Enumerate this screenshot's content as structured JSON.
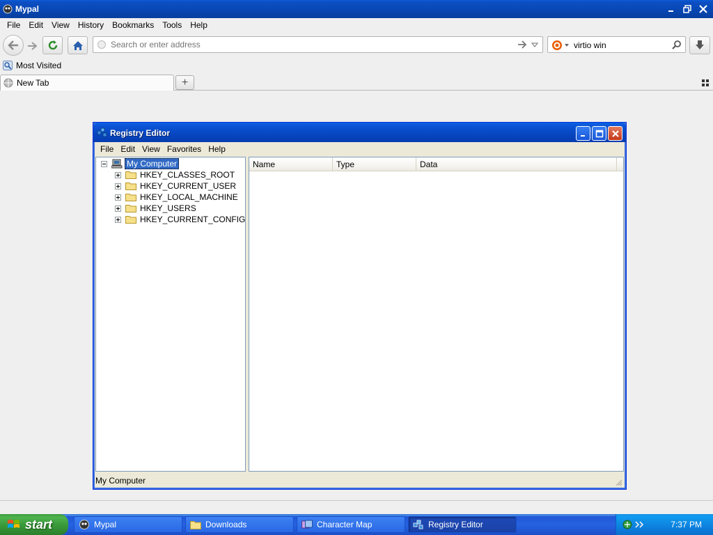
{
  "browser": {
    "title": "Mypal",
    "menu": [
      "File",
      "Edit",
      "View",
      "History",
      "Bookmarks",
      "Tools",
      "Help"
    ],
    "address_placeholder": "Search or enter address",
    "search_value": "virtio win",
    "bookmark_label": "Most Visited",
    "tab_label": "New Tab",
    "new_tab_symbol": "+"
  },
  "regedit": {
    "title": "Registry Editor",
    "menu": [
      "File",
      "Edit",
      "View",
      "Favorites",
      "Help"
    ],
    "root": "My Computer",
    "hives": [
      "HKEY_CLASSES_ROOT",
      "HKEY_CURRENT_USER",
      "HKEY_LOCAL_MACHINE",
      "HKEY_USERS",
      "HKEY_CURRENT_CONFIG"
    ],
    "columns": [
      "Name",
      "Type",
      "Data"
    ],
    "status": "My Computer"
  },
  "taskbar": {
    "start_label": "start",
    "buttons": [
      "Mypal",
      "Downloads",
      "Character Map",
      "Registry Editor"
    ],
    "clock": "7:37 PM"
  },
  "colors": {
    "xp_blue": "#0a5fd9",
    "selection": "#316ac5",
    "start_green": "#3b9b3b",
    "close_red": "#c3381b"
  }
}
